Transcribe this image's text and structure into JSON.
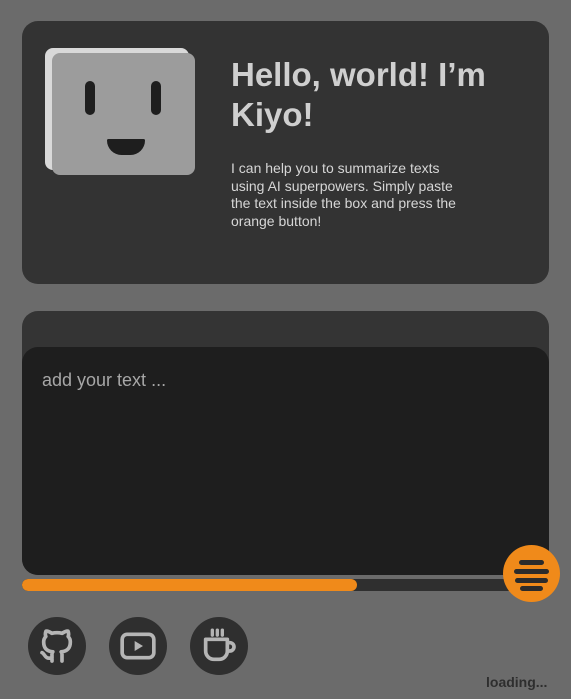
{
  "hero": {
    "title": "Hello, world! I’m Kiyo!",
    "description": "I can help you to summarize texts using AI superpowers. Simply paste the text inside the box and press the orange button!"
  },
  "editor": {
    "placeholder": "add your text ...",
    "value": ""
  },
  "progress": {
    "fraction": 0.67
  },
  "actions": {
    "summarize_icon": "lines-icon",
    "links": [
      {
        "name": "github-icon"
      },
      {
        "name": "youtube-icon"
      },
      {
        "name": "coffee-cup-icon"
      }
    ]
  },
  "status": "loading...",
  "colors": {
    "background": "#6b6b6b",
    "card": "#333333",
    "editor": "#1e1e1e",
    "accent": "#f08a1a",
    "robot": "#9c9c9c"
  }
}
